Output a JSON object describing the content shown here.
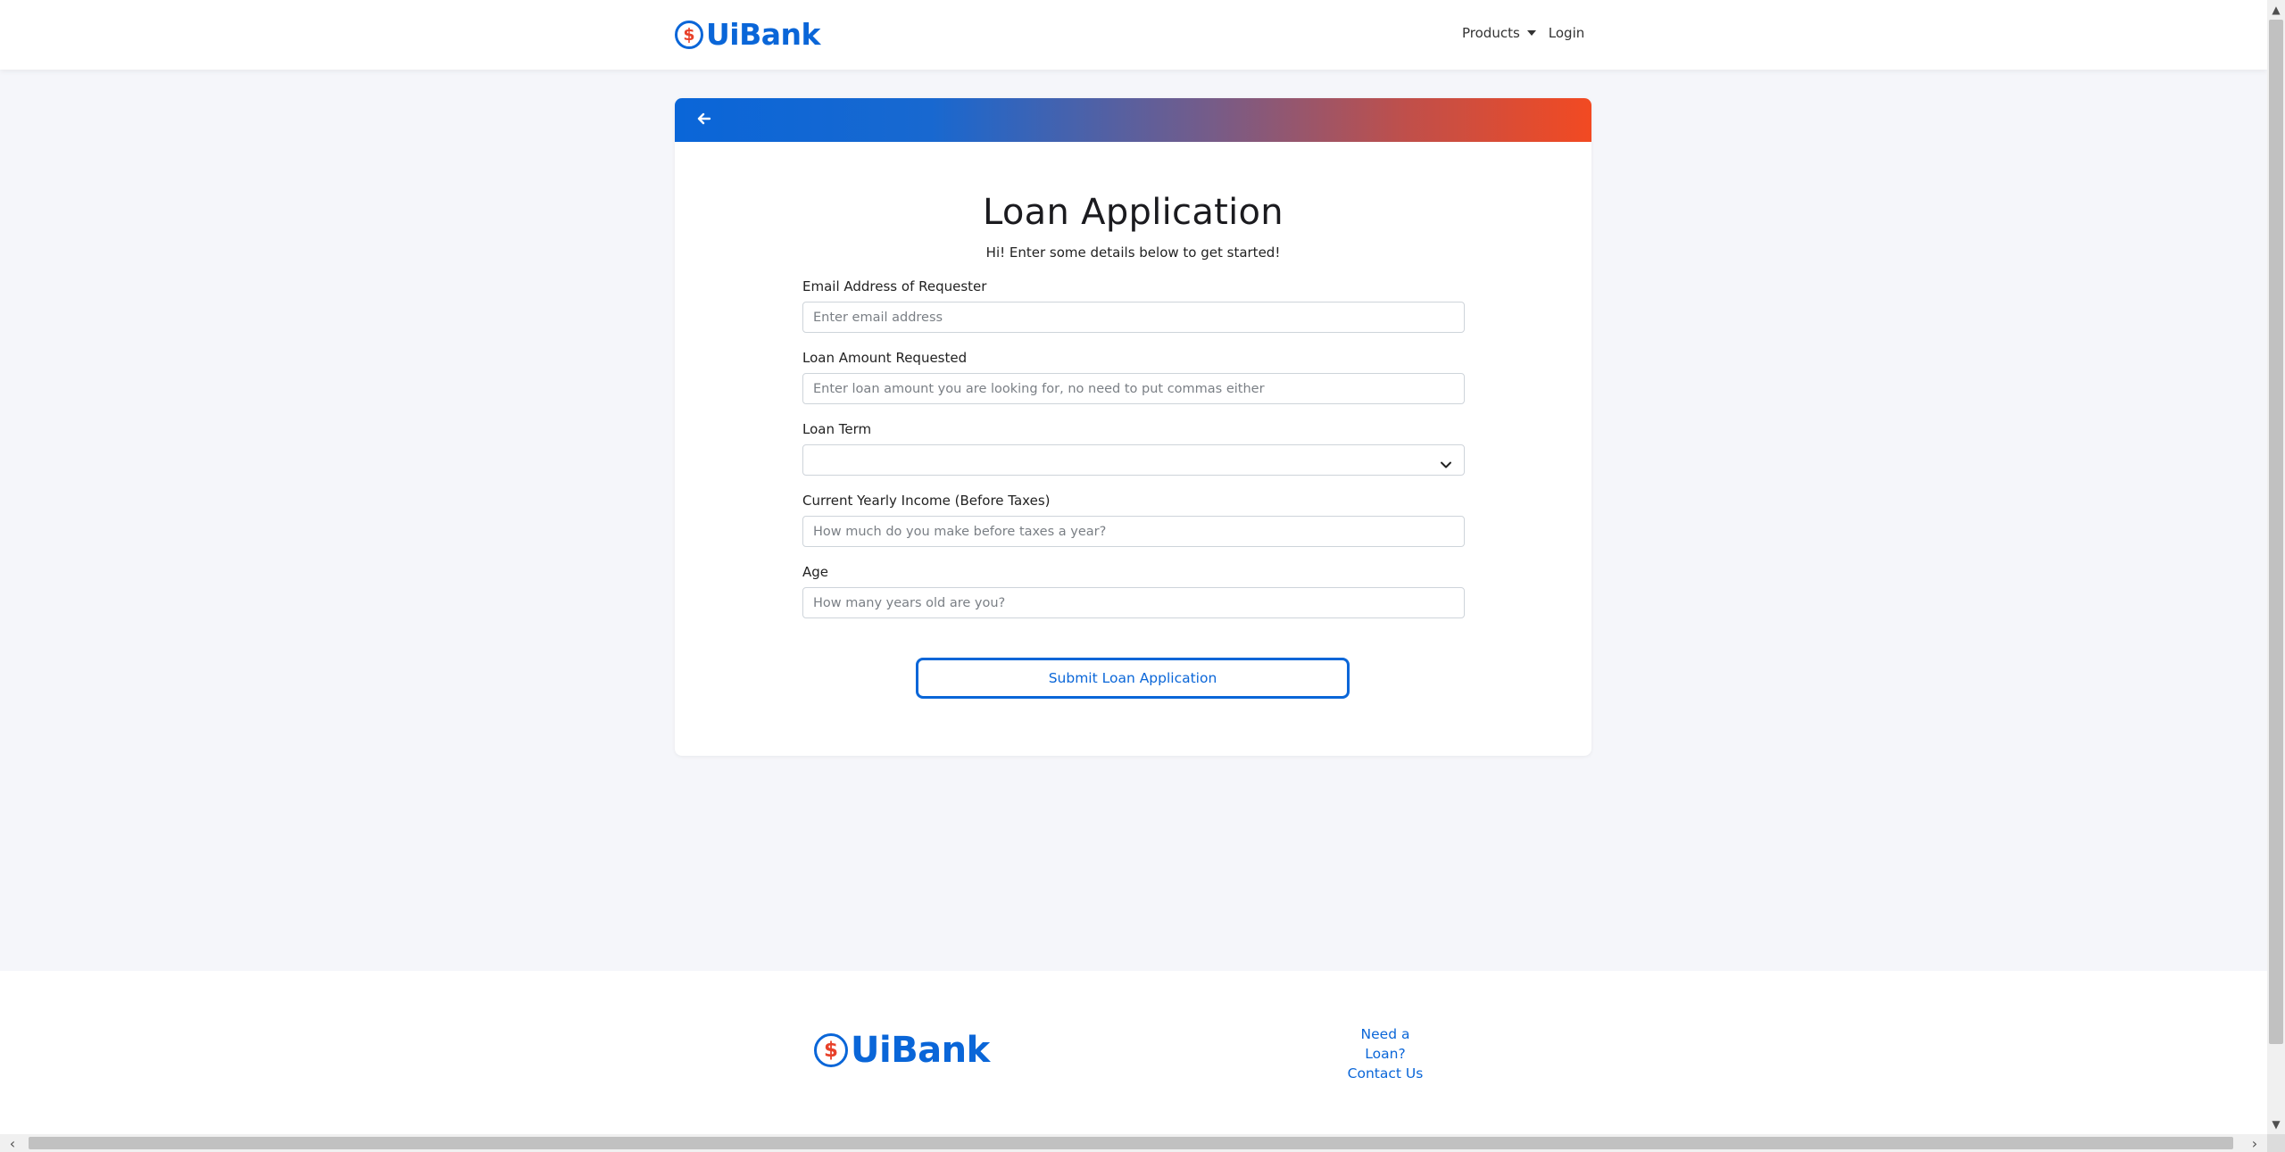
{
  "header": {
    "logo_text": "UiBank",
    "logo_badge": "$",
    "nav": {
      "products": "Products",
      "login": "Login"
    }
  },
  "card": {
    "title": "Loan Application",
    "subtitle": "Hi! Enter some details below to get started!",
    "fields": {
      "email": {
        "label": "Email Address of Requester",
        "placeholder": "Enter email address"
      },
      "amount": {
        "label": "Loan Amount Requested",
        "placeholder": "Enter loan amount you are looking for, no need to put commas either"
      },
      "term": {
        "label": "Loan Term",
        "value": ""
      },
      "income": {
        "label": "Current Yearly Income (Before Taxes)",
        "placeholder": "How much do you make before taxes a year?"
      },
      "age": {
        "label": "Age",
        "placeholder": "How many years old are you?"
      }
    },
    "submit_label": "Submit Loan Application"
  },
  "footer": {
    "logo_text": "UiBank",
    "logo_badge": "$",
    "links": {
      "loan": "Need a Loan?",
      "contact": "Contact Us"
    }
  },
  "colors": {
    "brand": "#0a66d8",
    "accent": "#f24a22",
    "page_bg": "#f5f6fa"
  },
  "icons": {
    "back": "arrow-left-icon",
    "select": "chevron-down-icon",
    "logo": "dollar-badge-icon"
  }
}
